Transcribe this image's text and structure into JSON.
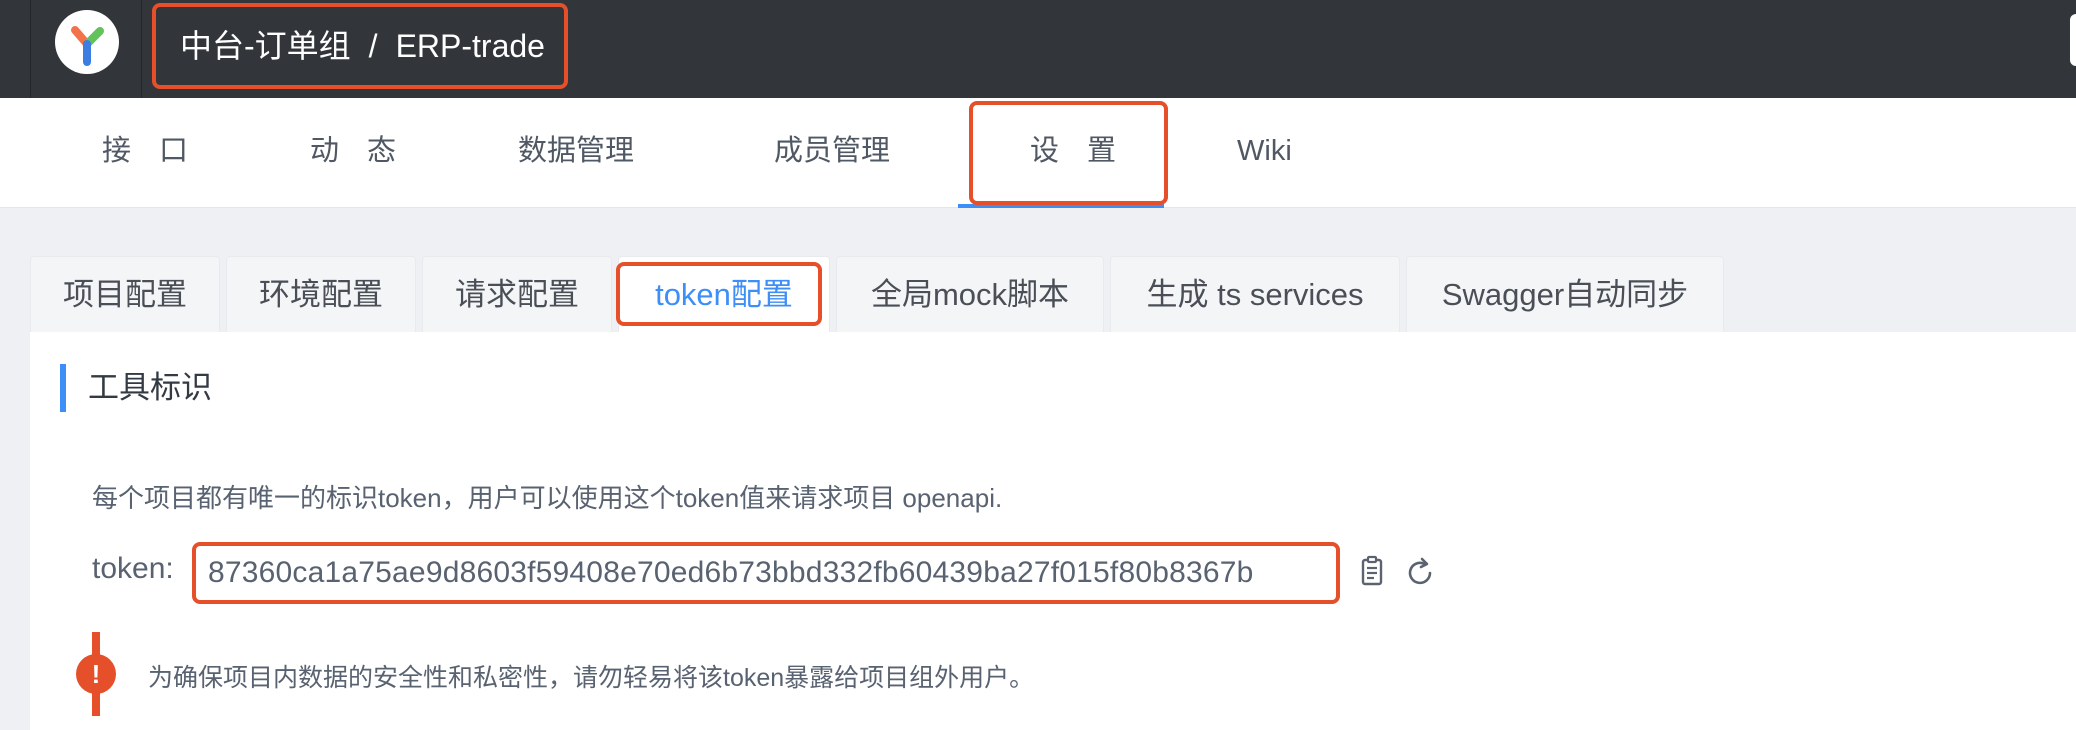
{
  "header": {
    "logo": "yapi-logo-icon",
    "breadcrumb": {
      "group": "中台-订单组",
      "separator": "/",
      "project": "ERP-trade"
    }
  },
  "nav": {
    "items": [
      {
        "label": "接 口"
      },
      {
        "label": "动 态"
      },
      {
        "label": "数据管理"
      },
      {
        "label": "成员管理"
      },
      {
        "label": "设 置",
        "active": true
      },
      {
        "label": "Wiki"
      }
    ]
  },
  "subtabs": {
    "items": [
      {
        "label": "项目配置"
      },
      {
        "label": "环境配置"
      },
      {
        "label": "请求配置"
      },
      {
        "label": "token配置",
        "active": true
      },
      {
        "label": "全局mock脚本"
      },
      {
        "label": "生成 ts services"
      },
      {
        "label": "Swagger自动同步"
      }
    ]
  },
  "token_section": {
    "title": "工具标识",
    "description": "每个项目都有唯一的标识token，用户可以使用这个token值来请求项目 openapi.",
    "token_label": "token:",
    "token_value": "87360ca1a75ae9d8603f59408e70ed6b73bbd332fb60439ba27f015f80b8367b",
    "copy_icon": "copy-icon",
    "refresh_icon": "refresh-icon",
    "warning": "为确保项目内数据的安全性和私密性，请勿轻易将该token暴露给项目组外用户。",
    "warning_icon_glyph": "!"
  },
  "colors": {
    "topbar": "#32363a",
    "accent": "#3e8ef7",
    "highlight": "#e5502a",
    "background": "#eef0f4"
  }
}
